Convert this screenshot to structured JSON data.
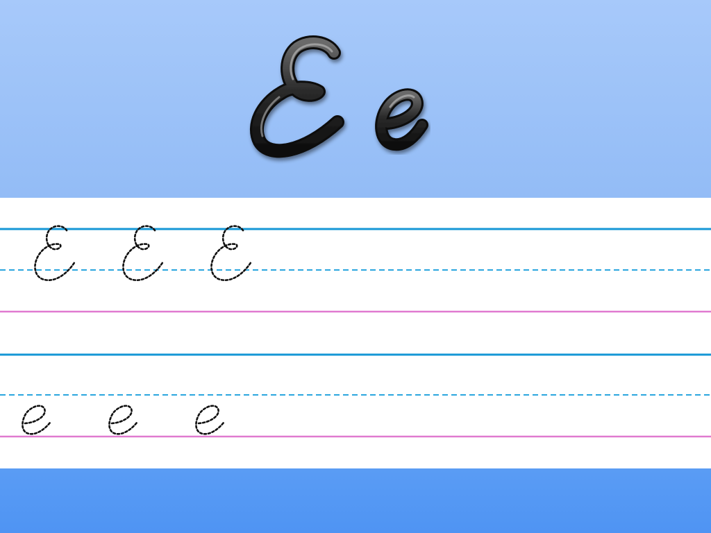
{
  "title": {
    "uppercase_letter": "E",
    "lowercase_letter": "e",
    "letter_style": "cursive"
  },
  "practice_rows": [
    {
      "letter": "E",
      "case": "uppercase",
      "repetitions": 3,
      "trace_style": "dotted"
    },
    {
      "letter": "e",
      "case": "lowercase",
      "repetitions": 3,
      "trace_style": "dotted"
    }
  ],
  "colors": {
    "header_background": "#9fc4f9",
    "footer_background": "#549af4",
    "practice_background": "#ffffff",
    "top_line": "#1597d6",
    "mid_line_dashed": "#2aa6de",
    "base_line": "#e07ad0",
    "title_letter_fill": "#1e1e1e",
    "trace_stroke": "#111111"
  }
}
